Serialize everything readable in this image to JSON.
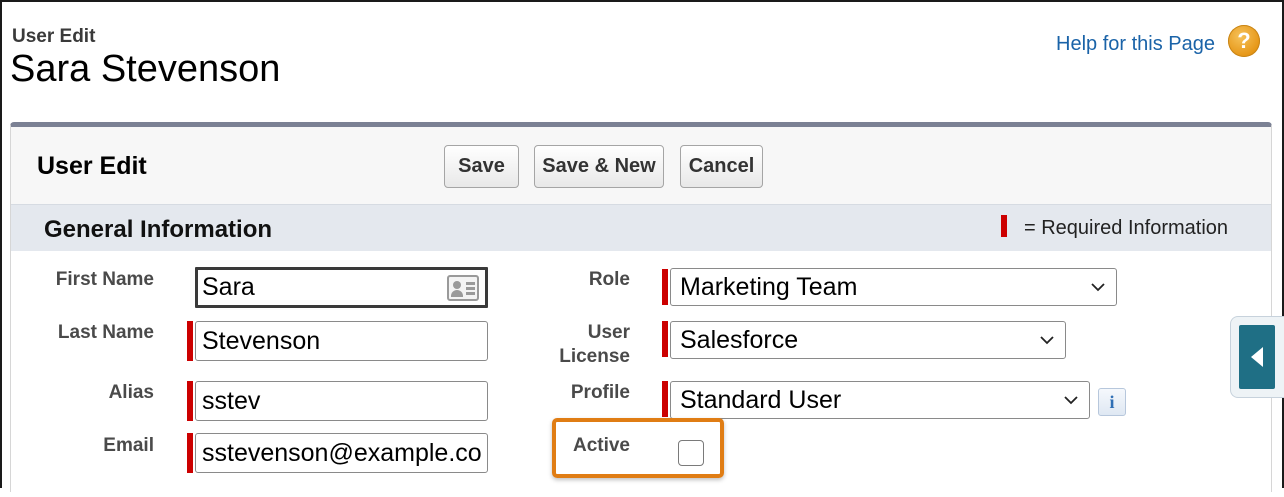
{
  "header": {
    "subtitle": "User Edit",
    "title": "Sara Stevenson",
    "help_link": "Help for this Page",
    "help_icon": "?"
  },
  "panel": {
    "title": "User Edit",
    "buttons": {
      "save": "Save",
      "save_new": "Save & New",
      "cancel": "Cancel"
    }
  },
  "section": {
    "title": "General Information",
    "required_legend": "= Required Information",
    "required_color": "#cc0000"
  },
  "fields": {
    "first_name": {
      "label": "First Name",
      "value": "Sara"
    },
    "last_name": {
      "label": "Last Name",
      "value": "Stevenson"
    },
    "alias": {
      "label": "Alias",
      "value": "sstev"
    },
    "email": {
      "label": "Email",
      "value": "sstevenson@example.com"
    },
    "role": {
      "label": "Role",
      "value": "Marketing Team"
    },
    "user_license": {
      "label_line1": "User",
      "label_line2": "License",
      "value": "Salesforce"
    },
    "profile": {
      "label": "Profile",
      "value": "Standard User",
      "info_icon": "i"
    },
    "active": {
      "label": "Active",
      "checked": false
    }
  },
  "colors": {
    "accent_link": "#1a63a8",
    "highlight": "#e07d14",
    "panel_top_border": "#7b8194",
    "side_tab": "#1f6f85"
  },
  "icons": {
    "help": "help-icon",
    "contact_card": "contact-card-icon",
    "chevron": "chevron-down-icon",
    "info": "info-icon",
    "collapse": "arrow-left-icon"
  }
}
